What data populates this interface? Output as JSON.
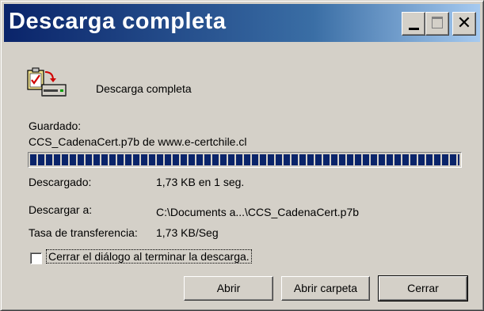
{
  "window": {
    "title": "Descarga completa"
  },
  "header": {
    "status_text": "Descarga completa"
  },
  "details": {
    "saved_label": "Guardado:",
    "saved_value": "CCS_CadenaCert.p7b de www.e-certchile.cl",
    "progress_fraction": 1.0,
    "downloaded_label": "Descargado:",
    "downloaded_value": "1,73 KB en 1 seg.",
    "download_to_label": "Descargar a:",
    "download_to_value": "C:\\Documents a...\\CCS_CadenaCert.p7b",
    "rate_label": "Tasa de transferencia:",
    "rate_value": "1,73 KB/Seg"
  },
  "options": {
    "close_on_finish_label": "Cerrar el diálogo al terminar la descarga.",
    "close_on_finish_checked": false
  },
  "buttons": {
    "open": "Abrir",
    "open_folder": "Abrir carpeta",
    "close": "Cerrar"
  },
  "icons": {
    "download_complete": "download-complete-icon",
    "minimize": "minimize-icon",
    "maximize": "maximize-icon",
    "close": "close-icon"
  },
  "colors": {
    "titlebar_start": "#0a246a",
    "titlebar_end": "#a6caf0",
    "progress": "#0a246a",
    "face": "#d4d0c8"
  }
}
